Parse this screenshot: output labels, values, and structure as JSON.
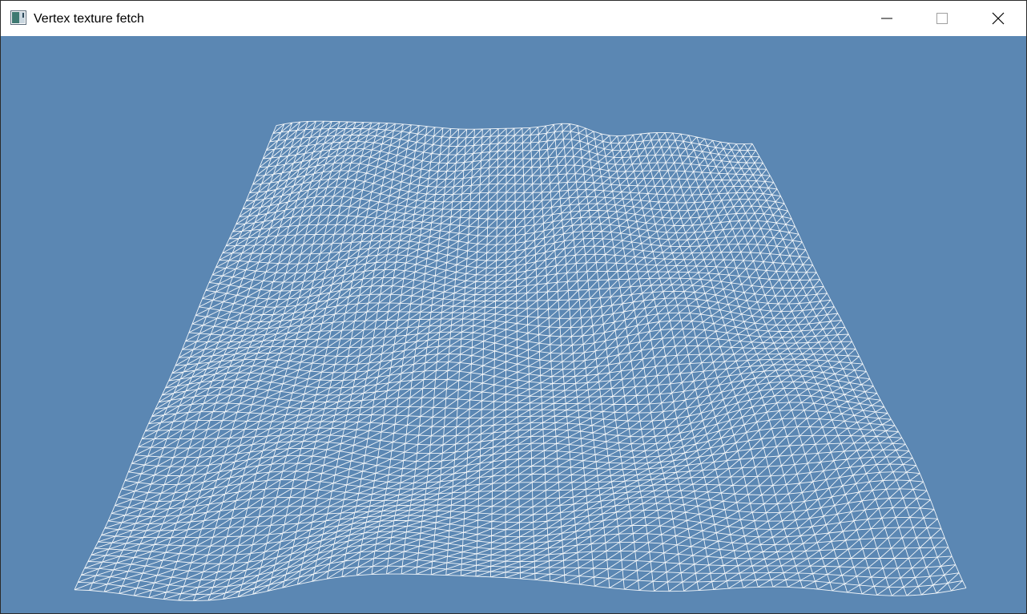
{
  "window": {
    "title": "Vertex texture fetch",
    "icon": "app-window-icon",
    "controls": [
      "minimize-icon",
      "maximize-icon",
      "close-icon"
    ]
  },
  "viewport": {
    "background_color": "#5b87b3",
    "content": "wireframe-terrain-mesh",
    "wire_color": "#ffffff"
  }
}
